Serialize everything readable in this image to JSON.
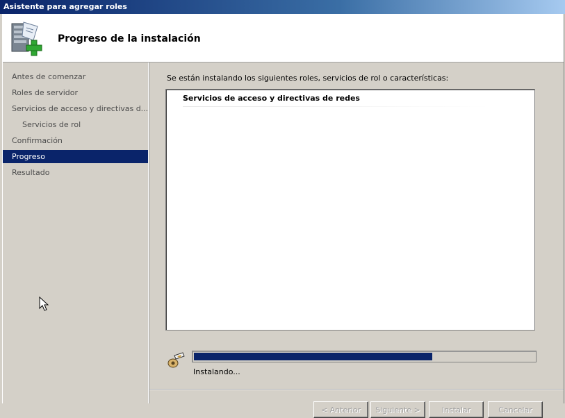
{
  "window": {
    "title": "Asistente para agregar roles"
  },
  "header": {
    "title": "Progreso de la instalación",
    "icon": "server-roles-add-icon"
  },
  "nav": {
    "items": [
      {
        "label": "Antes de comenzar",
        "indent": false,
        "active": false
      },
      {
        "label": "Roles de servidor",
        "indent": false,
        "active": false
      },
      {
        "label": "Servicios de acceso y directivas d...",
        "indent": false,
        "active": false
      },
      {
        "label": "Servicios de rol",
        "indent": true,
        "active": false
      },
      {
        "label": "Confirmación",
        "indent": false,
        "active": false
      },
      {
        "label": "Progreso",
        "indent": false,
        "active": true
      },
      {
        "label": "Resultado",
        "indent": false,
        "active": false
      }
    ]
  },
  "main": {
    "intro": "Se están instalando los siguientes roles, servicios de rol o características:",
    "list_items": [
      "Servicios de acceso y directivas de redes"
    ],
    "progress_fraction": 0.7,
    "status": "Instalando..."
  },
  "buttons": {
    "back": "< Anterior",
    "next": "Siguiente >",
    "install": "Instalar",
    "cancel": "Cancelar"
  },
  "colors": {
    "accent": "#0a246a",
    "dialog_bg": "#d4d0c8"
  }
}
